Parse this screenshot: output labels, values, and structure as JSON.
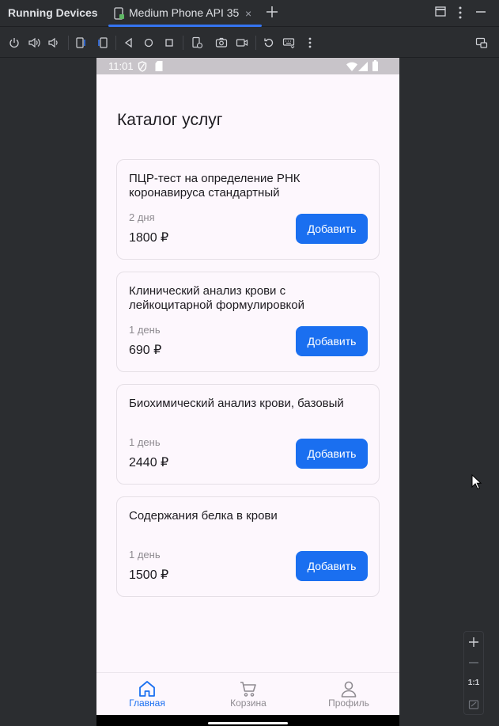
{
  "ide": {
    "panel_title": "Running Devices",
    "device_tab_label": "Medium Phone API 35",
    "tab_close": "×"
  },
  "colors": {
    "ide_background": "#2b2d30",
    "accent": "#3574f0",
    "app_background": "#fdf7fd",
    "button_blue": "#1a6ff0"
  },
  "toolbar": {
    "icons": [
      "power-icon",
      "volume-up-icon",
      "volume-down-icon",
      "rotate-left-icon",
      "rotate-right-icon",
      "back-icon",
      "home-icon",
      "overview-icon",
      "snapshot-icon",
      "screenshot-icon",
      "screen-record-icon",
      "reset-icon",
      "keyboard-icon",
      "more-icon",
      "mirror-icon"
    ]
  },
  "status_bar": {
    "time": "11:01"
  },
  "app": {
    "title": "Каталог услуг",
    "add_label": "Добавить",
    "services": [
      {
        "name": "ПЦР-тест на определение РНК коронавируса стандартный",
        "duration": "2 дня",
        "price": "1800 ₽"
      },
      {
        "name": "Клинический анализ крови с лейкоцитарной формулировкой",
        "duration": "1 день",
        "price": "690 ₽"
      },
      {
        "name": "Биохимический анализ крови, базовый",
        "duration": "1 день",
        "price": "2440 ₽"
      },
      {
        "name": "Содержания белка в крови",
        "duration": "1 день",
        "price": "1500 ₽"
      }
    ],
    "nav": [
      {
        "label": "Главная",
        "icon": "home-icon",
        "active": true
      },
      {
        "label": "Корзина",
        "icon": "cart-icon",
        "active": false
      },
      {
        "label": "Профиль",
        "icon": "profile-icon",
        "active": false
      }
    ]
  },
  "zoom": {
    "actual_size_label": "1:1"
  }
}
